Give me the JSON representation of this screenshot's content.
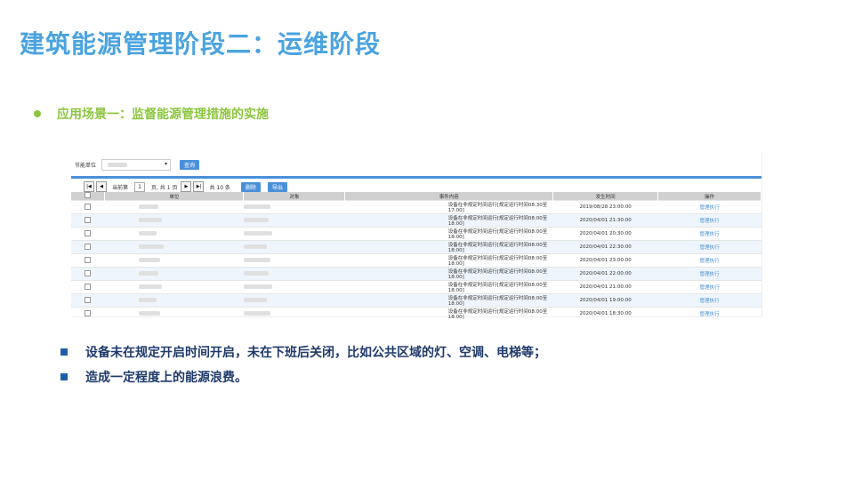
{
  "title": "建筑能源管理阶段二：运维阶段",
  "scene": "应用场景一：监督能源管理措施的实施",
  "screenshot": {
    "filter_label": "节能单位",
    "query_button": "查询",
    "pager": {
      "current_label": "当前第",
      "page_value": "1",
      "page_text": "页, 共 1 页",
      "total_text": "共 10 条",
      "delete_button": "删除",
      "export_button": "导出"
    },
    "columns": [
      "",
      "单位",
      "对象",
      "事件内容",
      "发生时间",
      "操作"
    ],
    "rows": [
      {
        "content": "设备在非规定时间运行[规定运行时间08:30至17:00]",
        "time": "2019/08/28 23:00:00",
        "action": "管理执行"
      },
      {
        "content": "设备在非规定时间运行[规定运行时间08:00至18:00]",
        "time": "2020/04/01 21:30:00",
        "action": "管理执行"
      },
      {
        "content": "设备在非规定时间运行[规定运行时间08:00至18:00]",
        "time": "2020/04/01 20:30:00",
        "action": "管理执行"
      },
      {
        "content": "设备在非规定时间运行[规定运行时间08:00至18:00]",
        "time": "2020/04/01 22:30:00",
        "action": "管理执行"
      },
      {
        "content": "设备在非规定时间运行[规定运行时间08:00至18:00]",
        "time": "2020/04/01 23:00:00",
        "action": "管理执行"
      },
      {
        "content": "设备在非规定时间运行[规定运行时间08:00至18:00]",
        "time": "2020/04/01 22:00:00",
        "action": "管理执行"
      },
      {
        "content": "设备在非规定时间运行[规定运行时间08:00至18:00]",
        "time": "2020/04/01 21:00:00",
        "action": "管理执行"
      },
      {
        "content": "设备在非规定时间运行[规定运行时间08:00至18:00]",
        "time": "2020/04/01 19:00:00",
        "action": "管理执行"
      },
      {
        "content": "设备在非规定时间运行[规定运行时间08:00至18:00]",
        "time": "2020/04/01 18:30:00",
        "action": "管理执行"
      }
    ]
  },
  "bullets": [
    "设备未在规定开启时间开启，未在下班后关闭，比如公共区域的灯、空调、电梯等；",
    "造成一定程度上的能源浪费。"
  ],
  "colors": {
    "title": "#4aa3df",
    "scene": "#8cc63f",
    "bullet": "#1f3a6b",
    "accent": "#4a90d9"
  }
}
